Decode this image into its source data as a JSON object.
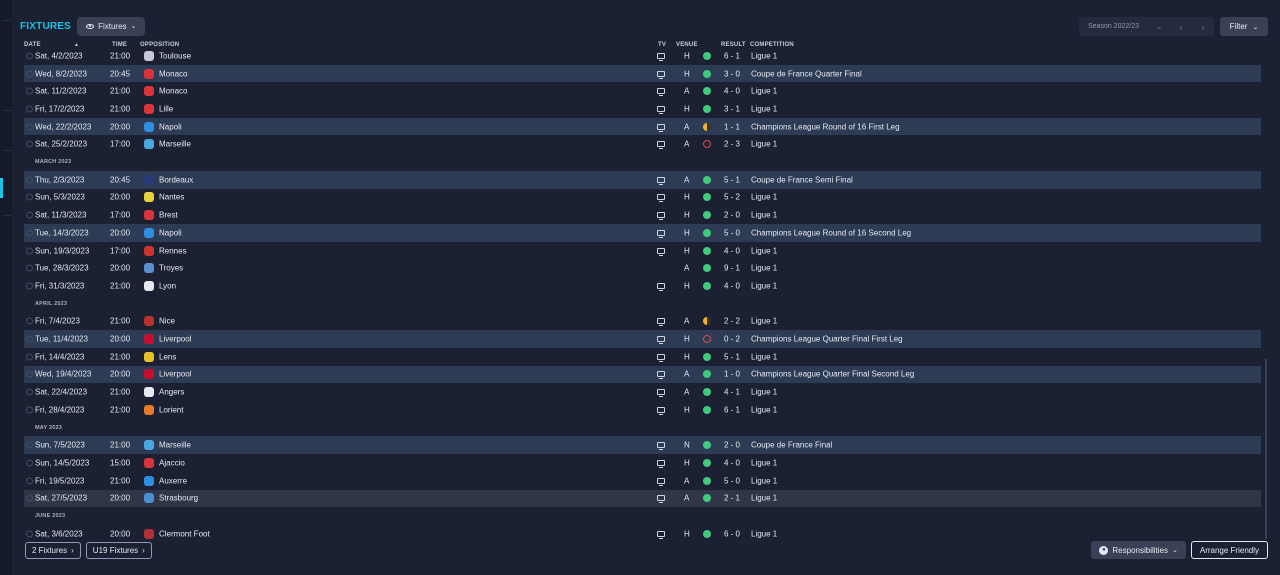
{
  "header": {
    "title": "FIXTURES",
    "view_label": "Fixtures"
  },
  "controls": {
    "season": "Season 2022/23",
    "filter_label": "Filter"
  },
  "columns": {
    "date": "DATE",
    "time": "TIME",
    "opposition": "OPPOSITION",
    "tv": "TV",
    "venue": "VENUE",
    "result": "RESULT",
    "competition": "COMPETITION"
  },
  "colors": {
    "accent": "#19c3e6",
    "win": "#3fca7d",
    "draw": "#f0b132",
    "loss": "#e0494a"
  },
  "rows": [
    {
      "type": "fixture",
      "date": "Sat, 4/2/2023",
      "time": "21:00",
      "opp": "Toulouse",
      "crest": "#c8c8d4",
      "tv": true,
      "venue": "H",
      "res": "w",
      "score": "6 - 1",
      "comp": "Ligue 1",
      "style": ""
    },
    {
      "type": "fixture",
      "date": "Wed, 8/2/2023",
      "time": "20:45",
      "opp": "Monaco",
      "crest": "#d9343a",
      "tv": true,
      "venue": "H",
      "res": "w",
      "score": "3 - 0",
      "comp": "Coupe de France Quarter Final",
      "style": "hl"
    },
    {
      "type": "fixture",
      "date": "Sat, 11/2/2023",
      "time": "21:00",
      "opp": "Monaco",
      "crest": "#d9343a",
      "tv": true,
      "venue": "A",
      "res": "w",
      "score": "4 - 0",
      "comp": "Ligue 1",
      "style": ""
    },
    {
      "type": "fixture",
      "date": "Fri, 17/2/2023",
      "time": "21:00",
      "opp": "Lille",
      "crest": "#d9343a",
      "tv": true,
      "venue": "H",
      "res": "w",
      "score": "3 - 1",
      "comp": "Ligue 1",
      "style": ""
    },
    {
      "type": "fixture",
      "date": "Wed, 22/2/2023",
      "time": "20:00",
      "opp": "Napoli",
      "crest": "#2e8fe0",
      "tv": true,
      "venue": "A",
      "res": "d",
      "score": "1 - 1",
      "comp": "Champions League Round of 16  First Leg",
      "style": "hl"
    },
    {
      "type": "fixture",
      "date": "Sat, 25/2/2023",
      "time": "17:00",
      "opp": "Marseille",
      "crest": "#4aa8e0",
      "tv": true,
      "venue": "A",
      "res": "l",
      "score": "2 - 3",
      "comp": "Ligue 1",
      "style": ""
    },
    {
      "type": "month",
      "label": "MARCH 2023"
    },
    {
      "type": "fixture",
      "date": "Thu, 2/3/2023",
      "time": "20:45",
      "opp": "Bordeaux",
      "crest": "#2a3a7a",
      "tv": true,
      "venue": "A",
      "res": "w",
      "score": "5 - 1",
      "comp": "Coupe de France Semi Final",
      "style": "hl"
    },
    {
      "type": "fixture",
      "date": "Sun, 5/3/2023",
      "time": "20:00",
      "opp": "Nantes",
      "crest": "#e6d23a",
      "tv": true,
      "venue": "H",
      "res": "w",
      "score": "5 - 2",
      "comp": "Ligue 1",
      "style": ""
    },
    {
      "type": "fixture",
      "date": "Sat, 11/3/2023",
      "time": "17:00",
      "opp": "Brest",
      "crest": "#d9343a",
      "tv": true,
      "venue": "H",
      "res": "w",
      "score": "2 - 0",
      "comp": "Ligue 1",
      "style": ""
    },
    {
      "type": "fixture",
      "date": "Tue, 14/3/2023",
      "time": "20:00",
      "opp": "Napoli",
      "crest": "#2e8fe0",
      "tv": true,
      "venue": "H",
      "res": "w",
      "score": "5 - 0",
      "comp": "Champions League Round of 16  Second Leg",
      "style": "hl"
    },
    {
      "type": "fixture",
      "date": "Sun, 19/3/2023",
      "time": "17:00",
      "opp": "Rennes",
      "crest": "#c9362b",
      "tv": true,
      "venue": "H",
      "res": "w",
      "score": "4 - 0",
      "comp": "Ligue 1",
      "style": ""
    },
    {
      "type": "fixture",
      "date": "Tue, 28/3/2023",
      "time": "20:00",
      "opp": "Troyes",
      "crest": "#5a8fd0",
      "tv": false,
      "venue": "A",
      "res": "w",
      "score": "9 - 1",
      "comp": "Ligue 1",
      "style": ""
    },
    {
      "type": "fixture",
      "date": "Fri, 31/3/2023",
      "time": "21:00",
      "opp": "Lyon",
      "crest": "#e6e9f0",
      "tv": true,
      "venue": "H",
      "res": "w",
      "score": "4 - 0",
      "comp": "Ligue 1",
      "style": ""
    },
    {
      "type": "month",
      "label": "APRIL 2023"
    },
    {
      "type": "fixture",
      "date": "Fri, 7/4/2023",
      "time": "21:00",
      "opp": "Nice",
      "crest": "#b8322a",
      "tv": true,
      "venue": "A",
      "res": "d",
      "score": "2 - 2",
      "comp": "Ligue 1",
      "style": ""
    },
    {
      "type": "fixture",
      "date": "Tue, 11/4/2023",
      "time": "20:00",
      "opp": "Liverpool",
      "crest": "#c8102e",
      "tv": true,
      "venue": "H",
      "res": "l",
      "score": "0 - 2",
      "comp": "Champions League Quarter Final First Leg",
      "style": "hl"
    },
    {
      "type": "fixture",
      "date": "Fri, 14/4/2023",
      "time": "21:00",
      "opp": "Lens",
      "crest": "#e6c22a",
      "tv": true,
      "venue": "H",
      "res": "w",
      "score": "5 - 1",
      "comp": "Ligue 1",
      "style": ""
    },
    {
      "type": "fixture",
      "date": "Wed, 19/4/2023",
      "time": "20:00",
      "opp": "Liverpool",
      "crest": "#c8102e",
      "tv": true,
      "venue": "A",
      "res": "w",
      "score": "1 - 0",
      "comp": "Champions League Quarter Final Second Leg",
      "style": "hl"
    },
    {
      "type": "fixture",
      "date": "Sat, 22/4/2023",
      "time": "21:00",
      "opp": "Angers",
      "crest": "#e6e9f0",
      "tv": true,
      "venue": "A",
      "res": "w",
      "score": "4 - 1",
      "comp": "Ligue 1",
      "style": ""
    },
    {
      "type": "fixture",
      "date": "Fri, 28/4/2023",
      "time": "21:00",
      "opp": "Lorient",
      "crest": "#e87a2a",
      "tv": true,
      "venue": "H",
      "res": "w",
      "score": "6 - 1",
      "comp": "Ligue 1",
      "style": ""
    },
    {
      "type": "month",
      "label": "MAY 2023"
    },
    {
      "type": "fixture",
      "date": "Sun, 7/5/2023",
      "time": "21:00",
      "opp": "Marseille",
      "crest": "#4aa8e0",
      "tv": true,
      "venue": "N",
      "res": "w",
      "score": "2 - 0",
      "comp": "Coupe de France Final",
      "style": "hl"
    },
    {
      "type": "fixture",
      "date": "Sun, 14/5/2023",
      "time": "15:00",
      "opp": "Ajaccio",
      "crest": "#d9343a",
      "tv": true,
      "venue": "H",
      "res": "w",
      "score": "4 - 0",
      "comp": "Ligue 1",
      "style": ""
    },
    {
      "type": "fixture",
      "date": "Fri, 19/5/2023",
      "time": "21:00",
      "opp": "Auxerre",
      "crest": "#2e8fe0",
      "tv": true,
      "venue": "A",
      "res": "w",
      "score": "5 - 0",
      "comp": "Ligue 1",
      "style": ""
    },
    {
      "type": "fixture",
      "date": "Sat, 27/5/2023",
      "time": "20:00",
      "opp": "Strasbourg",
      "crest": "#4a8fd0",
      "tv": true,
      "venue": "A",
      "res": "w",
      "score": "2 - 1",
      "comp": "Ligue 1",
      "style": "hl2"
    },
    {
      "type": "month",
      "label": "JUNE 2023"
    },
    {
      "type": "fixture",
      "date": "Sat, 3/6/2023",
      "time": "20:00",
      "opp": "Clermont Foot",
      "crest": "#b0303a",
      "tv": true,
      "venue": "H",
      "res": "w",
      "score": "6 - 0",
      "comp": "Ligue 1",
      "style": ""
    }
  ],
  "footer": {
    "fixtures2_label": "2 Fixtures",
    "u19_label": "U19 Fixtures",
    "responsibilities_label": "Responsibilities",
    "arrange_label": "Arrange Friendly"
  }
}
